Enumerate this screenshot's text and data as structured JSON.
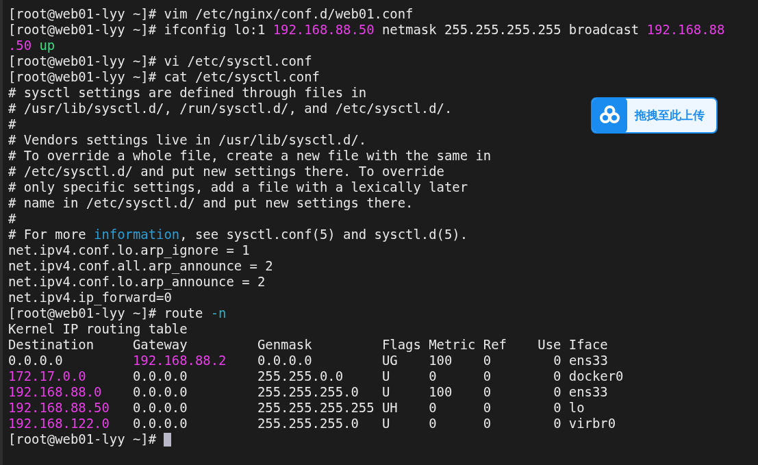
{
  "terminal": {
    "lines": [
      {
        "segments": [
          {
            "text": "[root@web01-lyy ~]# vim /etc/nginx/conf.d/web01.conf",
            "kind": "plain"
          }
        ]
      },
      {
        "segments": [
          {
            "text": "[root@web01-lyy ~]# ifconfig lo:1 ",
            "kind": "plain"
          },
          {
            "text": "192.168.88.50",
            "kind": "magenta"
          },
          {
            "text": " netmask 255.255.255.255 broadcast ",
            "kind": "plain"
          },
          {
            "text": "192.168.88",
            "kind": "magenta"
          }
        ]
      },
      {
        "segments": [
          {
            "text": ".50",
            "kind": "magenta"
          },
          {
            "text": " up",
            "kind": "green"
          }
        ]
      },
      {
        "segments": [
          {
            "text": "[root@web01-lyy ~]# vi /etc/sysctl.conf",
            "kind": "plain"
          }
        ]
      },
      {
        "segments": [
          {
            "text": "[root@web01-lyy ~]# cat /etc/sysctl.conf",
            "kind": "plain"
          }
        ]
      },
      {
        "segments": [
          {
            "text": "# sysctl settings are defined through files in",
            "kind": "plain"
          }
        ]
      },
      {
        "segments": [
          {
            "text": "# /usr/lib/sysctl.d/, /run/sysctl.d/, and /etc/sysctl.d/.",
            "kind": "plain"
          }
        ]
      },
      {
        "segments": [
          {
            "text": "#",
            "kind": "plain"
          }
        ]
      },
      {
        "segments": [
          {
            "text": "# Vendors settings live in /usr/lib/sysctl.d/.",
            "kind": "plain"
          }
        ]
      },
      {
        "segments": [
          {
            "text": "# To override a whole file, create a new file with the same in",
            "kind": "plain"
          }
        ]
      },
      {
        "segments": [
          {
            "text": "# /etc/sysctl.d/ and put new settings there. To override",
            "kind": "plain"
          }
        ]
      },
      {
        "segments": [
          {
            "text": "# only specific settings, add a file with a lexically later",
            "kind": "plain"
          }
        ]
      },
      {
        "segments": [
          {
            "text": "# name in /etc/sysctl.d/ and put new settings there.",
            "kind": "plain"
          }
        ]
      },
      {
        "segments": [
          {
            "text": "#",
            "kind": "plain"
          }
        ]
      },
      {
        "segments": [
          {
            "text": "# For more ",
            "kind": "plain"
          },
          {
            "text": "information",
            "kind": "blue"
          },
          {
            "text": ", see sysctl.conf(5) and sysctl.d(5).",
            "kind": "plain"
          }
        ]
      },
      {
        "segments": [
          {
            "text": "net.ipv4.conf.lo.arp_ignore = 1",
            "kind": "plain"
          }
        ]
      },
      {
        "segments": [
          {
            "text": "net.ipv4.conf.all.arp_announce = 2",
            "kind": "plain"
          }
        ]
      },
      {
        "segments": [
          {
            "text": "net.ipv4.conf.lo.arp_announce = 2",
            "kind": "plain"
          }
        ]
      },
      {
        "segments": [
          {
            "text": "net.ipv4.ip_forward=0",
            "kind": "plain"
          }
        ]
      },
      {
        "segments": [
          {
            "text": "[root@web01-lyy ~]# route ",
            "kind": "plain"
          },
          {
            "text": "-n",
            "kind": "cyan"
          }
        ]
      },
      {
        "segments": [
          {
            "text": "Kernel IP routing table",
            "kind": "plain"
          }
        ]
      },
      {
        "segments": [
          {
            "text": "Destination     Gateway         Genmask         Flags Metric Ref    Use Iface",
            "kind": "plain"
          }
        ]
      },
      {
        "segments": [
          {
            "text": "0.0.0.0         ",
            "kind": "plain"
          },
          {
            "text": "192.168.88.2",
            "kind": "magenta"
          },
          {
            "text": "    0.0.0.0         UG    100    0        0 ens33",
            "kind": "plain"
          }
        ]
      },
      {
        "segments": [
          {
            "text": "172.17.0.0",
            "kind": "magenta"
          },
          {
            "text": "      0.0.0.0         255.255.0.0     U     0      0        0 docker0",
            "kind": "plain"
          }
        ]
      },
      {
        "segments": [
          {
            "text": "192.168.88.0",
            "kind": "magenta"
          },
          {
            "text": "    0.0.0.0         255.255.255.0   U     100    0        0 ens33",
            "kind": "plain"
          }
        ]
      },
      {
        "segments": [
          {
            "text": "192.168.88.50",
            "kind": "magenta"
          },
          {
            "text": "   0.0.0.0         255.255.255.255 UH    0      0        0 lo",
            "kind": "plain"
          }
        ]
      },
      {
        "segments": [
          {
            "text": "192.168.122.0",
            "kind": "magenta"
          },
          {
            "text": "   0.0.0.0         255.255.255.0   U     0      0        0 virbr0",
            "kind": "plain"
          }
        ]
      },
      {
        "segments": [
          {
            "text": "[root@web01-lyy ~]# ",
            "kind": "plain"
          }
        ],
        "cursor": true
      }
    ]
  },
  "upload_widget": {
    "label": "拖拽至此上传"
  }
}
